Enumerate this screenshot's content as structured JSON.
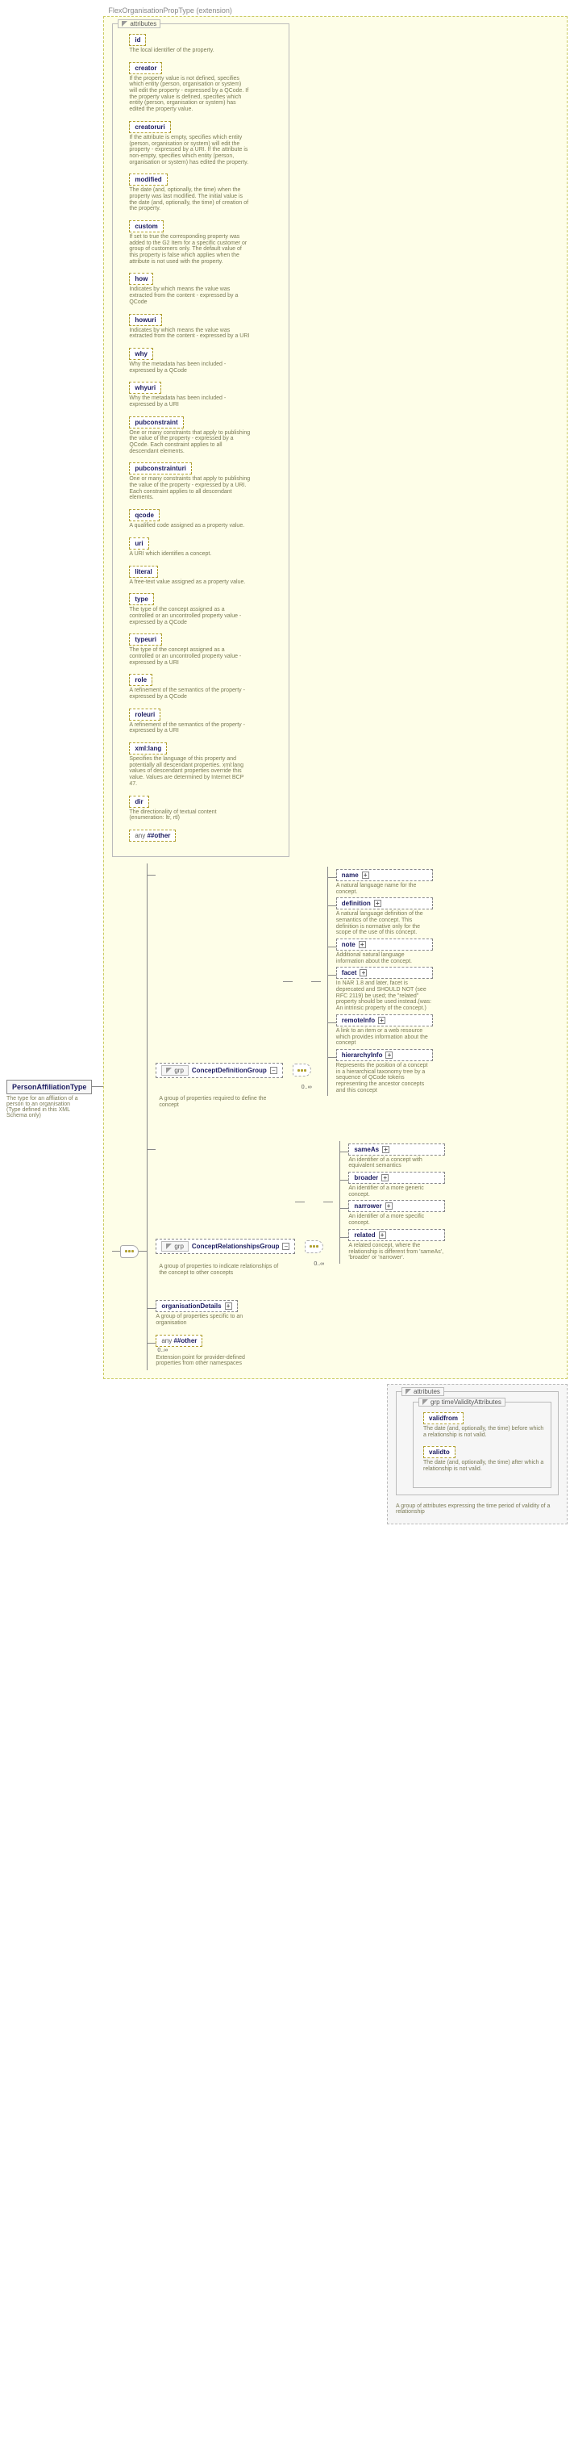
{
  "root": {
    "name": "PersonAffiliationType",
    "desc": "The type for an affliation of a person to an organisation (Type defined in this XML Schema only)"
  },
  "extension": {
    "label": "FlexOrganisationPropType (extension)"
  },
  "attributes_label": "attributes",
  "attributes": [
    {
      "name": "id",
      "desc": "The local identifier of the property."
    },
    {
      "name": "creator",
      "desc": "If the property value is not defined, specifies which entity (person, organisation or system) will edit the property - expressed by a QCode. If the property value is defined, specifies which entity (person, organisation or system) has edited the property value."
    },
    {
      "name": "creatoruri",
      "desc": "If the attribute is empty, specifies which entity (person, organisation or system) will edit the property - expressed by a URI. If the attribute is non-empty, specifies which entity (person, organisation or system) has edited the property."
    },
    {
      "name": "modified",
      "desc": "The date (and, optionally, the time) when the property was last modified. The initial value is the date (and, optionally, the time) of creation of the property."
    },
    {
      "name": "custom",
      "desc": "If set to true the corresponding property was added to the G2 Item for a specific customer or group of customers only. The default value of this property is false which applies when the attribute is not used with the property."
    },
    {
      "name": "how",
      "desc": "Indicates by which means the value was extracted from the content - expressed by a QCode"
    },
    {
      "name": "howuri",
      "desc": "Indicates by which means the value was extracted from the content - expressed by a URI"
    },
    {
      "name": "why",
      "desc": "Why the metadata has been included - expressed by a QCode"
    },
    {
      "name": "whyuri",
      "desc": "Why the metadata has been included - expressed by a URI"
    },
    {
      "name": "pubconstraint",
      "desc": "One or many constraints that apply to publishing the value of the property - expressed by a QCode. Each constraint applies to all descendant elements."
    },
    {
      "name": "pubconstrainturi",
      "desc": "One or many constraints that apply to publishing the value of the property - expressed by a URI. Each constraint applies to all descendant elements."
    },
    {
      "name": "qcode",
      "desc": "A qualified code assigned as a property value."
    },
    {
      "name": "uri",
      "desc": "A URI which identifies a concept."
    },
    {
      "name": "literal",
      "desc": "A free-text value assigned as a property value."
    },
    {
      "name": "type",
      "desc": "The type of the concept assigned as a controlled or an uncontrolled property value - expressed by a QCode"
    },
    {
      "name": "typeuri",
      "desc": "The type of the concept assigned as a controlled or an uncontrolled property value - expressed by a URI"
    },
    {
      "name": "role",
      "desc": "A refinement of the semantics of the property - expressed by a QCode"
    },
    {
      "name": "roleuri",
      "desc": "A refinement of the semantics of the property - expressed by a URI"
    },
    {
      "name": "xml:lang",
      "desc": "Specifies the language of this property and potentially all descendant properties. xml:lang values of descendant properties override this value. Values are determined by Internet BCP 47."
    },
    {
      "name": "dir",
      "desc": "The directionality of textual content (enumeration: ltr, rtl)"
    }
  ],
  "any_attr": {
    "prefix": "any",
    "suffix": "##other"
  },
  "groups": {
    "cdg": {
      "name": "ConceptDefinitionGroup",
      "desc": "A group of properties required to define the concept",
      "card": "0..∞"
    },
    "crg": {
      "name": "ConceptRelationshipsGroup",
      "desc": "A group of properties to indicate relationships of the concept to other concepts",
      "card": "0..∞"
    }
  },
  "cdg_children": [
    {
      "name": "name",
      "desc": "A natural language name for the concept."
    },
    {
      "name": "definition",
      "desc": "A natural language definition of the semantics of the concept. This definition is normative only for the scope of the use of this concept."
    },
    {
      "name": "note",
      "desc": "Additional natural language information about the concept."
    },
    {
      "name": "facet",
      "desc": "In NAR 1.8 and later, facet is deprecated and SHOULD NOT (see RFC 2119) be used; the \"related\" property should be used instead.(was: An intrinsic property of the concept.)"
    },
    {
      "name": "remoteInfo",
      "desc": "A link to an item or a web resource which provides information about the concept"
    },
    {
      "name": "hierarchyInfo",
      "desc": "Represents the position of a concept in a hierarchical taxonomy tree by a sequence of QCode tokens representing the ancestor concepts and this concept"
    }
  ],
  "crg_children": [
    {
      "name": "sameAs",
      "desc": "An identifier of a concept with equivalent semantics"
    },
    {
      "name": "broader",
      "desc": "An identifier of a more generic concept."
    },
    {
      "name": "narrower",
      "desc": "An identifier of a more specific concept."
    },
    {
      "name": "related",
      "desc": "A related concept, where the relationship is different from 'sameAs', 'broader' or 'narrower'."
    }
  ],
  "orgDetails": {
    "name": "organisationDetails",
    "desc": "A group of properties specific to an organisation"
  },
  "any_el": {
    "prefix": "any",
    "suffix": "##other",
    "card": "0..∞",
    "desc": "Extension point for provider-defined properties from other namespaces"
  },
  "validity": {
    "group_label": "grp timeValidityAttributes",
    "attributes_label": "attributes",
    "attrs": [
      {
        "name": "validfrom",
        "desc": "The date (and, optionally, the time) before which a relationship is not valid."
      },
      {
        "name": "validto",
        "desc": "The date (and, optionally, the time) after which a relationship is not valid."
      }
    ],
    "desc": "A group of attributes expressing the time period of validity of a relationship"
  }
}
